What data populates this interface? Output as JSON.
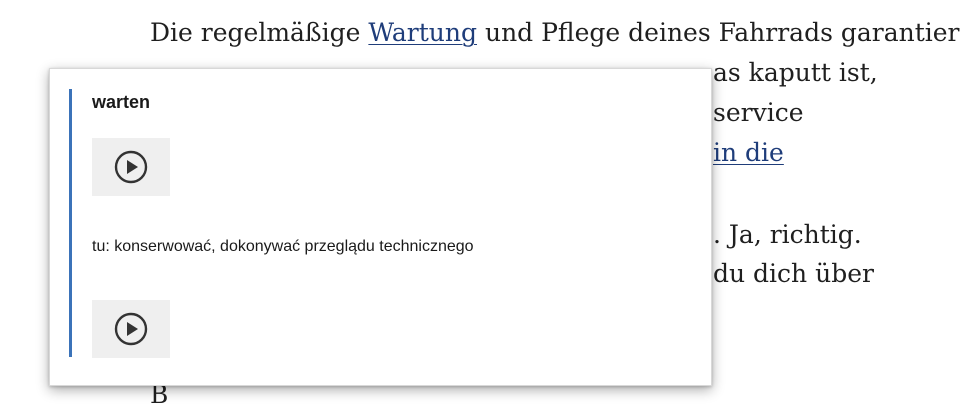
{
  "article": {
    "line1_pre": "Die regelmäßige ",
    "line1_link": "Wartung",
    "line1_post": " und Pflege deines Fahrrads garantiert",
    "line2_visible": "as kaputt ist,",
    "line3_visible": "service",
    "line4_link": "in die",
    "line5_visible": ". Ja, richtig.",
    "line6_visible": "du dich über",
    "line7_visible": "B",
    "colors": {
      "text": "#1f1f1f",
      "link": "#1f3d7a"
    }
  },
  "popup": {
    "headword": "warten",
    "translation": "tu: konserwować, dokonywać przeglądu technicznego",
    "audio_icon": "play-circle-icon",
    "colors": {
      "accent": "#3b73b9",
      "audio_bg": "#efefef"
    }
  }
}
